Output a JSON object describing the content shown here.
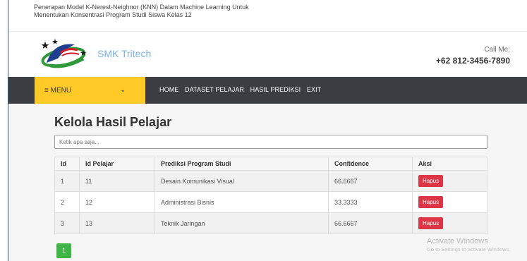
{
  "header": {
    "title_line1": "Penerapan Model K-Nerest-Neighnor (KNN) Dalam Machine Learning Untuk",
    "title_line2": "Menentukan Konsentrasi Program Studi Siswa Kelas 12"
  },
  "brand": {
    "name": "SMK Tritech",
    "call_label": "Call Me:",
    "phone": "+62 812-3456-7890"
  },
  "nav": {
    "menu_label": "≡ MENU",
    "links": [
      "HOME",
      "DATASET PELAJAR",
      "HASIL PREDIKSI",
      "EXIT"
    ]
  },
  "main": {
    "title": "Kelola Hasil Pelajar",
    "search_placeholder": "Ketik apa saja...",
    "columns": [
      "Id",
      "Id Pelajar",
      "Prediksi Program Studi",
      "Confidence",
      "Aksi"
    ],
    "rows": [
      {
        "id": "1",
        "id_pelajar": "11",
        "prediksi": "Desain Komunikasi Visual",
        "confidence": "66.6667",
        "action": "Hapus"
      },
      {
        "id": "2",
        "id_pelajar": "12",
        "prediksi": "Administrasi Bisnis",
        "confidence": "33.3333",
        "action": "Hapus"
      },
      {
        "id": "3",
        "id_pelajar": "13",
        "prediksi": "Teknik Jaringan",
        "confidence": "66.6667",
        "action": "Hapus"
      }
    ],
    "page": "1"
  },
  "watermark": {
    "title": "Activate Windows",
    "subtitle": "Go to Settings to activate Windows."
  },
  "colors": {
    "menu_yellow": "#ffc928",
    "navbar_dark": "#3b3d40",
    "delete_red": "#dc3545",
    "page_green": "#3fb547",
    "brand_blue": "#7bb2e3"
  }
}
